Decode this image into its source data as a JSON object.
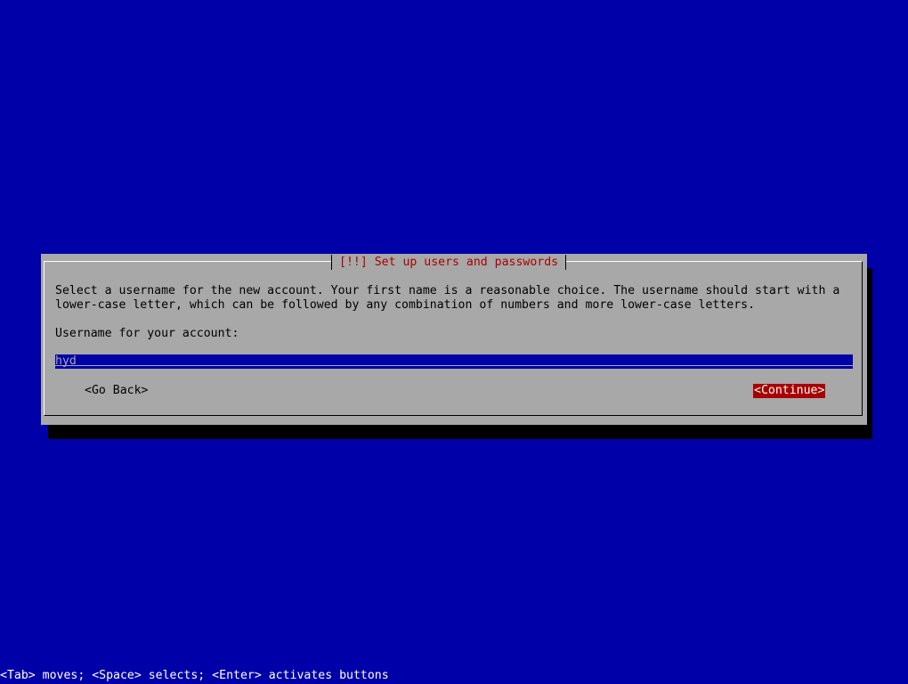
{
  "dialog": {
    "title": "[!!] Set up users and passwords",
    "description_line_1": "Select a username for the new account. Your first name is a reasonable choice. The username should start with a",
    "description_line_2": "lower-case letter, which can be followed by any combination of numbers and more lower-case letters.",
    "field_label": "Username for your account:",
    "username_value": "hyd",
    "buttons": {
      "back_label": "<Go Back>",
      "continue_label": "<Continue>"
    }
  },
  "status_bar": {
    "help_text": "<Tab> moves; <Space> selects; <Enter> activates buttons"
  },
  "colors": {
    "background": "#0000a8",
    "dialog": "#a8a8a8",
    "title": "#a80000",
    "selected_button": "#a80000"
  }
}
